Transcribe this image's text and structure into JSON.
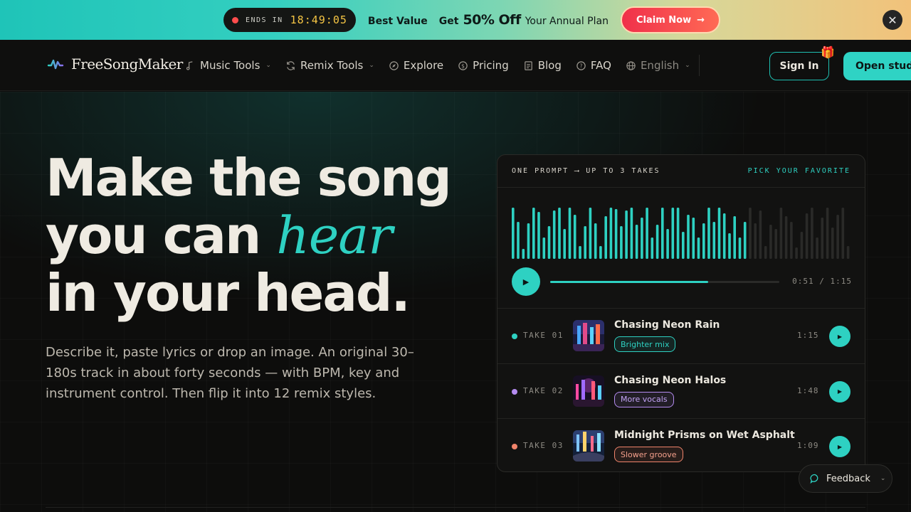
{
  "promo": {
    "ends_label": "ENDS IN",
    "countdown": "18:49:05",
    "best_value": "Best Value",
    "get": "Get",
    "discount": "50% Off",
    "plan": "Your Annual Plan",
    "cta": "Claim Now",
    "cta_arrow": "→",
    "close": "✕"
  },
  "nav": {
    "brand": "FreeSongMaker",
    "items": [
      {
        "label": "Music Tools",
        "icon": "music-note-icon",
        "dropdown": true
      },
      {
        "label": "Remix Tools",
        "icon": "refresh-icon",
        "dropdown": true
      },
      {
        "label": "Explore",
        "icon": "compass-icon",
        "dropdown": false
      },
      {
        "label": "Pricing",
        "icon": "dollar-icon",
        "dropdown": false
      },
      {
        "label": "Blog",
        "icon": "document-icon",
        "dropdown": false
      },
      {
        "label": "FAQ",
        "icon": "question-icon",
        "dropdown": false
      }
    ],
    "language": "English",
    "sign_in": "Sign In",
    "open_studio": "Open studio"
  },
  "hero": {
    "line1": "Make the song",
    "line2_a": "you can",
    "line2_accent": "hear",
    "line3": "in your head.",
    "subtitle": "Describe it, paste lyrics or drop an image. An original 30–180s track in about forty seconds — with BPM, key and instrument control. Then flip it into 12 remix styles."
  },
  "card": {
    "header_left": "ONE PROMPT ⟶ UP TO 3 TAKES",
    "header_right": "PICK YOUR FAVORITE",
    "time": "0:51 / 1:15",
    "progress": 0.69,
    "accent_color": "#2ed1c2",
    "takes": [
      {
        "label": "TAKE 01",
        "title": "Chasing Neon Rain",
        "tag": "Brighter mix",
        "duration": "1:15",
        "color": "#2ed1c2"
      },
      {
        "label": "TAKE 02",
        "title": "Chasing Neon Halos",
        "tag": "More vocals",
        "duration": "1:48",
        "color": "#b58cf0"
      },
      {
        "label": "TAKE 03",
        "title": "Midnight Prisms on Wet Asphalt",
        "tag": "Slower groove",
        "duration": "1:09",
        "color": "#f0846b"
      }
    ]
  },
  "feedback": {
    "label": "Feedback"
  }
}
